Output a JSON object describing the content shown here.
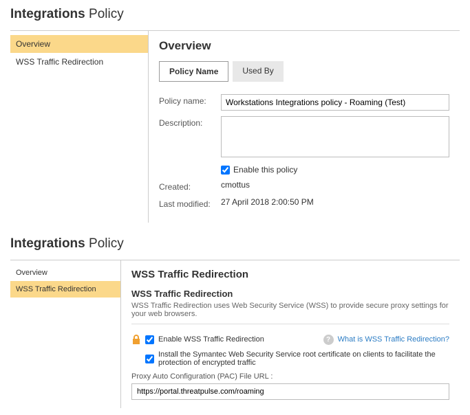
{
  "panel1": {
    "title_bold": "Integrations",
    "title_rest": "Policy",
    "sidebar": {
      "items": [
        {
          "label": "Overview",
          "active": true
        },
        {
          "label": "WSS Traffic Redirection",
          "active": false
        }
      ]
    },
    "heading": "Overview",
    "tabs": [
      {
        "label": "Policy Name",
        "active": true
      },
      {
        "label": "Used By",
        "active": false
      }
    ],
    "form": {
      "policy_name_label": "Policy name:",
      "policy_name_value": "Workstations Integrations policy - Roaming (Test)",
      "description_label": "Description:",
      "description_value": "",
      "enable_label": "Enable this policy",
      "enable_checked": true,
      "created_label": "Created:",
      "created_value": "cmottus",
      "modified_label": "Last modified:",
      "modified_value": "27 April 2018 2:00:50 PM"
    }
  },
  "panel2": {
    "title_bold": "Integrations",
    "title_rest": "Policy",
    "sidebar": {
      "items": [
        {
          "label": "Overview",
          "active": false
        },
        {
          "label": "WSS Traffic Redirection",
          "active": true
        }
      ]
    },
    "heading": "WSS Traffic Redirection",
    "sub_heading": "WSS Traffic Redirection",
    "sub_desc": "WSS Traffic Redirection uses Web Security Service (WSS) to provide secure proxy settings for your web browsers.",
    "enable_wss_label": "Enable WSS Traffic Redirection",
    "enable_wss_checked": true,
    "help_link": "What is WSS Traffic Redirection?",
    "install_cert_label": "Install the Symantec Web Security Service root certificate on clients to facilitate the protection of encrypted traffic",
    "install_cert_checked": true,
    "pac_label": "Proxy Auto Configuration (PAC) File URL :",
    "pac_value": "https://portal.threatpulse.com/roaming"
  }
}
